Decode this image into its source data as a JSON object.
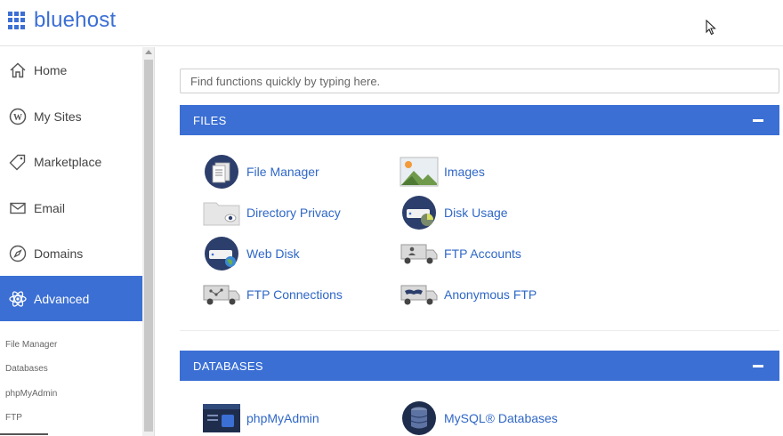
{
  "header": {
    "logo_text": "bluehost"
  },
  "sidebar": {
    "items": [
      {
        "label": "Home",
        "icon": "home-icon"
      },
      {
        "label": "My Sites",
        "icon": "wordpress-icon"
      },
      {
        "label": "Marketplace",
        "icon": "tag-icon"
      },
      {
        "label": "Email",
        "icon": "envelope-icon"
      },
      {
        "label": "Domains",
        "icon": "compass-icon"
      },
      {
        "label": "Advanced",
        "icon": "atom-icon",
        "active": true
      }
    ],
    "subitems": [
      "File Manager",
      "Databases",
      "phpMyAdmin",
      "FTP"
    ]
  },
  "search": {
    "placeholder": "Find functions quickly by typing here."
  },
  "sections": [
    {
      "title": "FILES",
      "tools": [
        {
          "label": "File Manager",
          "icon": "file-manager-icon"
        },
        {
          "label": "Images",
          "icon": "images-icon"
        },
        {
          "label": "Directory Privacy",
          "icon": "directory-privacy-icon"
        },
        {
          "label": "Disk Usage",
          "icon": "disk-usage-icon"
        },
        {
          "label": "Web Disk",
          "icon": "web-disk-icon"
        },
        {
          "label": "FTP Accounts",
          "icon": "ftp-accounts-icon"
        },
        {
          "label": "FTP Connections",
          "icon": "ftp-connections-icon"
        },
        {
          "label": "Anonymous FTP",
          "icon": "anonymous-ftp-icon"
        }
      ]
    },
    {
      "title": "DATABASES",
      "tools": [
        {
          "label": "phpMyAdmin",
          "icon": "phpmyadmin-icon"
        },
        {
          "label": "MySQL® Databases",
          "icon": "mysql-databases-icon"
        }
      ]
    }
  ],
  "colors": {
    "brand": "#3b6fd4",
    "link": "#2f67c7"
  }
}
